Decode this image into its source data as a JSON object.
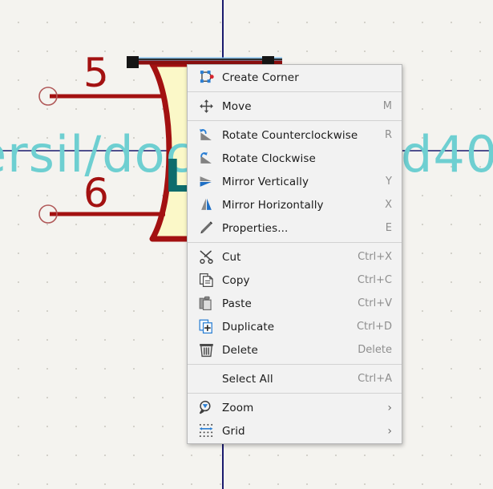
{
  "canvas": {
    "background_color": "#f4f3ef",
    "grid_dot_color": "#c8c6bd",
    "wire_color": "#a31111",
    "symbol_outline_color": "#a31111",
    "symbol_fill_color": "#fbf8c8",
    "net_line_color": "#1a1a6e",
    "overlay_text_color": "#6ecfd1",
    "reference_text_color": "#0e6c6c",
    "selection_color": "#58a6e0",
    "text_left": "ersil/doc",
    "text_right": "d40,",
    "reference_label": "L",
    "pin_numbers": [
      "5",
      "6"
    ]
  },
  "context_menu": {
    "groups": [
      {
        "items": [
          {
            "label": "Create Corner",
            "accel": "",
            "icon": "create-corner-icon",
            "submenu": false
          }
        ]
      },
      {
        "items": [
          {
            "label": "Move",
            "accel": "M",
            "icon": "move-icon",
            "submenu": false
          }
        ]
      },
      {
        "items": [
          {
            "label": "Rotate Counterclockwise",
            "accel": "R",
            "icon": "rotate-counterclockwise-icon",
            "submenu": false
          },
          {
            "label": "Rotate Clockwise",
            "accel": "",
            "icon": "rotate-clockwise-icon",
            "submenu": false
          },
          {
            "label": "Mirror Vertically",
            "accel": "Y",
            "icon": "mirror-vertically-icon",
            "submenu": false
          },
          {
            "label": "Mirror Horizontally",
            "accel": "X",
            "icon": "mirror-horizontally-icon",
            "submenu": false
          },
          {
            "label": "Properties...",
            "accel": "E",
            "icon": "properties-pencil-icon",
            "submenu": false
          }
        ]
      },
      {
        "items": [
          {
            "label": "Cut",
            "accel": "Ctrl+X",
            "icon": "cut-scissors-icon",
            "submenu": false
          },
          {
            "label": "Copy",
            "accel": "Ctrl+C",
            "icon": "copy-icon",
            "submenu": false
          },
          {
            "label": "Paste",
            "accel": "Ctrl+V",
            "icon": "paste-clipboard-icon",
            "submenu": false
          },
          {
            "label": "Duplicate",
            "accel": "Ctrl+D",
            "icon": "duplicate-icon",
            "submenu": false
          },
          {
            "label": "Delete",
            "accel": "Delete",
            "icon": "delete-trash-icon",
            "submenu": false
          }
        ]
      },
      {
        "items": [
          {
            "label": "Select All",
            "accel": "Ctrl+A",
            "icon": "",
            "submenu": false
          }
        ]
      },
      {
        "items": [
          {
            "label": "Zoom",
            "accel": "",
            "icon": "zoom-magnifier-icon",
            "submenu": true
          },
          {
            "label": "Grid",
            "accel": "",
            "icon": "grid-icon",
            "submenu": true
          }
        ]
      }
    ],
    "submenu_arrow": "›"
  }
}
